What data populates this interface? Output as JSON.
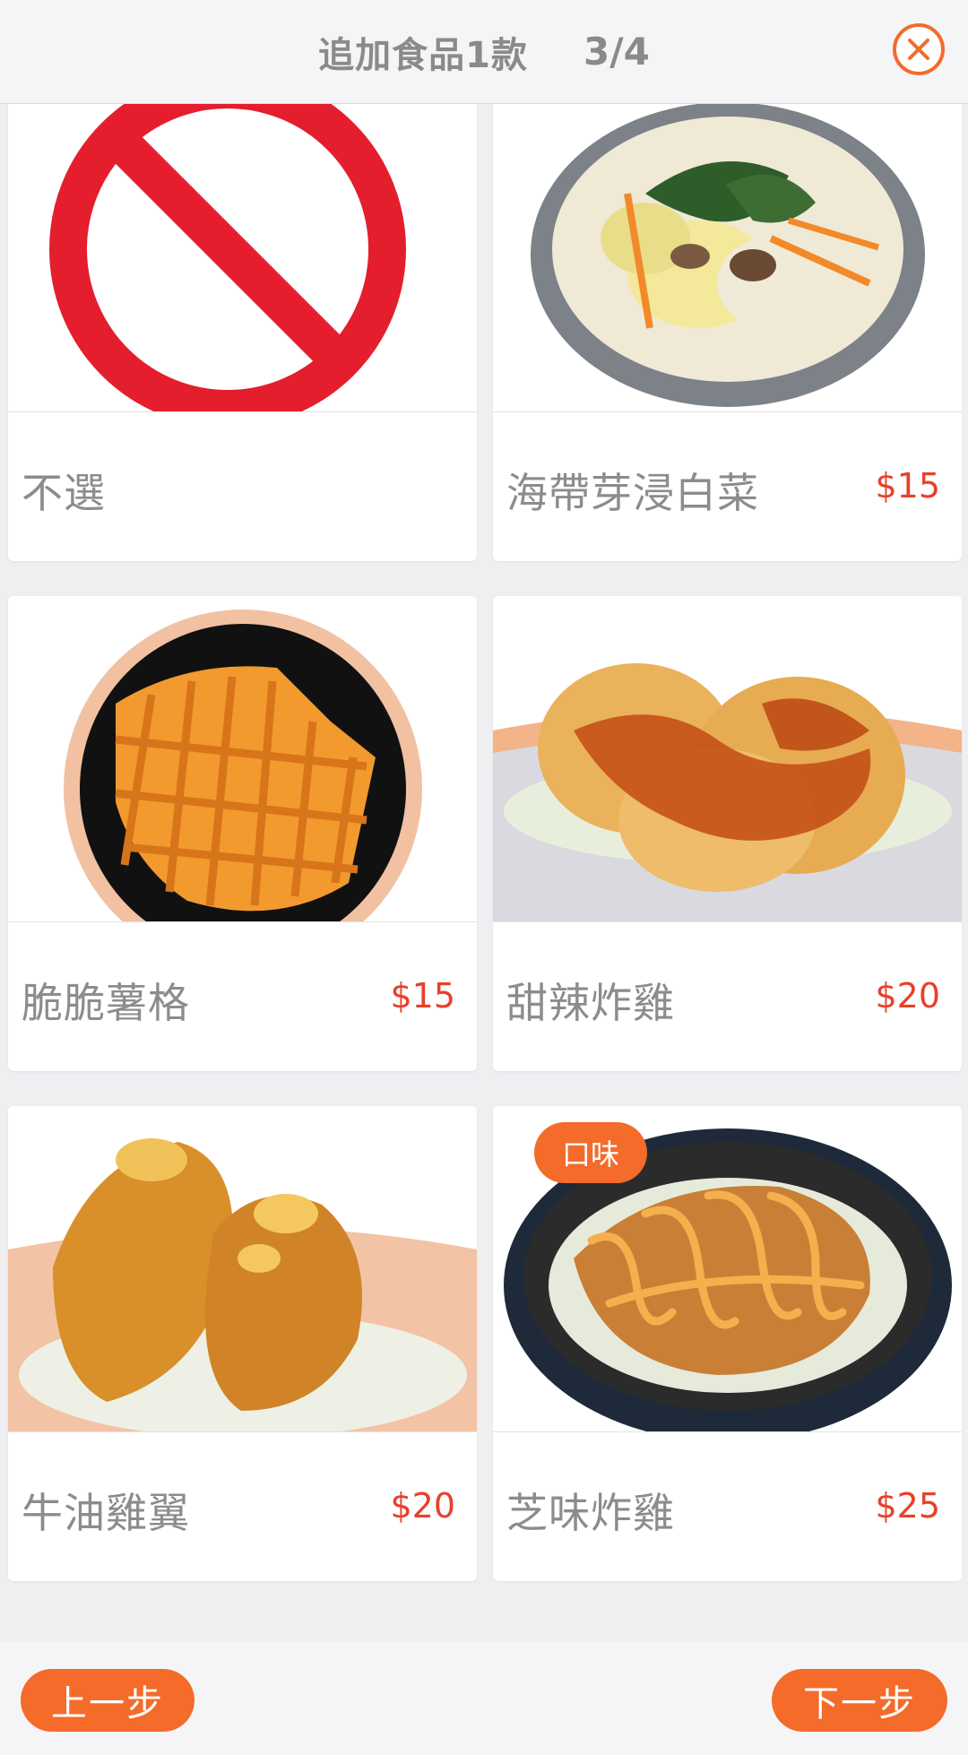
{
  "header": {
    "title": "追加食品1款",
    "step": "3/4",
    "close_icon": "close-circle-icon",
    "accent": "#f46b2a"
  },
  "items": [
    {
      "name": "不選",
      "price": "",
      "image": "prohibited-icon"
    },
    {
      "name": "海帶芽浸白菜",
      "price": "$15",
      "image": "cabbage-soup-bowl"
    },
    {
      "name": "脆脆薯格",
      "price": "$15",
      "image": "waffle-fries-bowl"
    },
    {
      "name": "甜辣炸雞",
      "price": "$20",
      "image": "sweet-chili-chicken-bowl"
    },
    {
      "name": "牛油雞翼",
      "price": "$20",
      "image": "butter-chicken-wings-bowl"
    },
    {
      "name": "芝味炸雞",
      "price": "$25",
      "image": "cheese-fried-chicken-bowl",
      "badge": "口味"
    }
  ],
  "footer": {
    "prev_label": "上一步",
    "next_label": "下一步"
  },
  "colors": {
    "price": "#e8402a",
    "button": "#f46b2a",
    "text": "#8c8c8c"
  }
}
